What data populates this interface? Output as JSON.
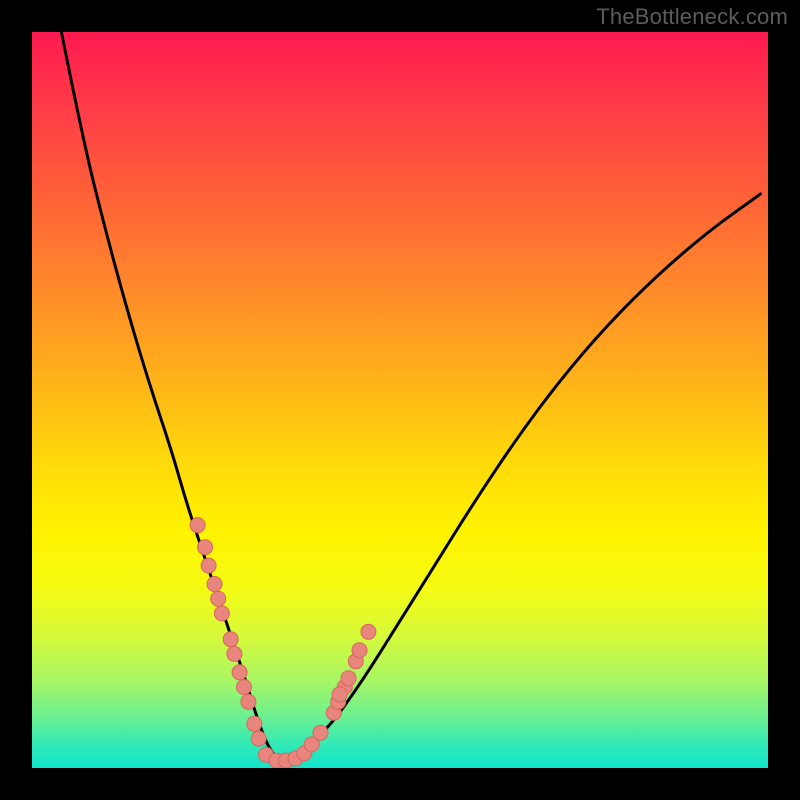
{
  "watermark": "TheBottleneck.com",
  "colors": {
    "gradient_top": "#ff1a50",
    "gradient_bottom": "#11e4cb",
    "curve": "#000000",
    "dot": "#e8867d",
    "dot_stroke": "#d9655c",
    "frame": "#000000"
  },
  "chart_data": {
    "type": "line",
    "title": "",
    "xlabel": "",
    "ylabel": "",
    "xlim": [
      0,
      100
    ],
    "ylim": [
      0,
      100
    ],
    "notes": "No axes, ticks, or numeric labels are shown. Curve is a V-shaped bottleneck profile; x/y values below are pixel-percent estimates within the inner plot area (0,0 = top-left). Dots are data markers clustered near the valley.",
    "series": [
      {
        "name": "bottleneck-curve",
        "x": [
          4,
          7,
          10,
          13,
          16,
          19,
          21,
          23,
          25,
          27,
          29,
          30.5,
          32,
          33.5,
          35,
          40,
          45,
          50,
          55,
          60,
          66,
          72,
          78,
          85,
          92,
          99
        ],
        "y": [
          0,
          15,
          27,
          38,
          48,
          57,
          64,
          70,
          76,
          82,
          88,
          93,
          97,
          99,
          99,
          95,
          88,
          80,
          72,
          64,
          55,
          47,
          40,
          33,
          27,
          22
        ]
      }
    ],
    "dots": [
      {
        "x": 22.5,
        "y": 67
      },
      {
        "x": 23.5,
        "y": 70
      },
      {
        "x": 24.0,
        "y": 72.5
      },
      {
        "x": 24.8,
        "y": 75
      },
      {
        "x": 25.3,
        "y": 77
      },
      {
        "x": 25.8,
        "y": 79
      },
      {
        "x": 27.0,
        "y": 82.5
      },
      {
        "x": 27.5,
        "y": 84.5
      },
      {
        "x": 28.2,
        "y": 87
      },
      {
        "x": 28.8,
        "y": 89
      },
      {
        "x": 29.4,
        "y": 91
      },
      {
        "x": 30.2,
        "y": 94
      },
      {
        "x": 30.8,
        "y": 96
      },
      {
        "x": 31.8,
        "y": 98.2
      },
      {
        "x": 33.2,
        "y": 99
      },
      {
        "x": 34.5,
        "y": 99
      },
      {
        "x": 35.8,
        "y": 98.7
      },
      {
        "x": 37.0,
        "y": 98
      },
      {
        "x": 38.0,
        "y": 96.8
      },
      {
        "x": 39.2,
        "y": 95.2
      },
      {
        "x": 41.0,
        "y": 92.5
      },
      {
        "x": 41.6,
        "y": 91
      },
      {
        "x": 42.5,
        "y": 89
      },
      {
        "x": 43.0,
        "y": 87.8
      },
      {
        "x": 44.0,
        "y": 85.5
      },
      {
        "x": 44.5,
        "y": 84
      },
      {
        "x": 45.7,
        "y": 81.5
      },
      {
        "x": 41.8,
        "y": 90
      }
    ]
  }
}
